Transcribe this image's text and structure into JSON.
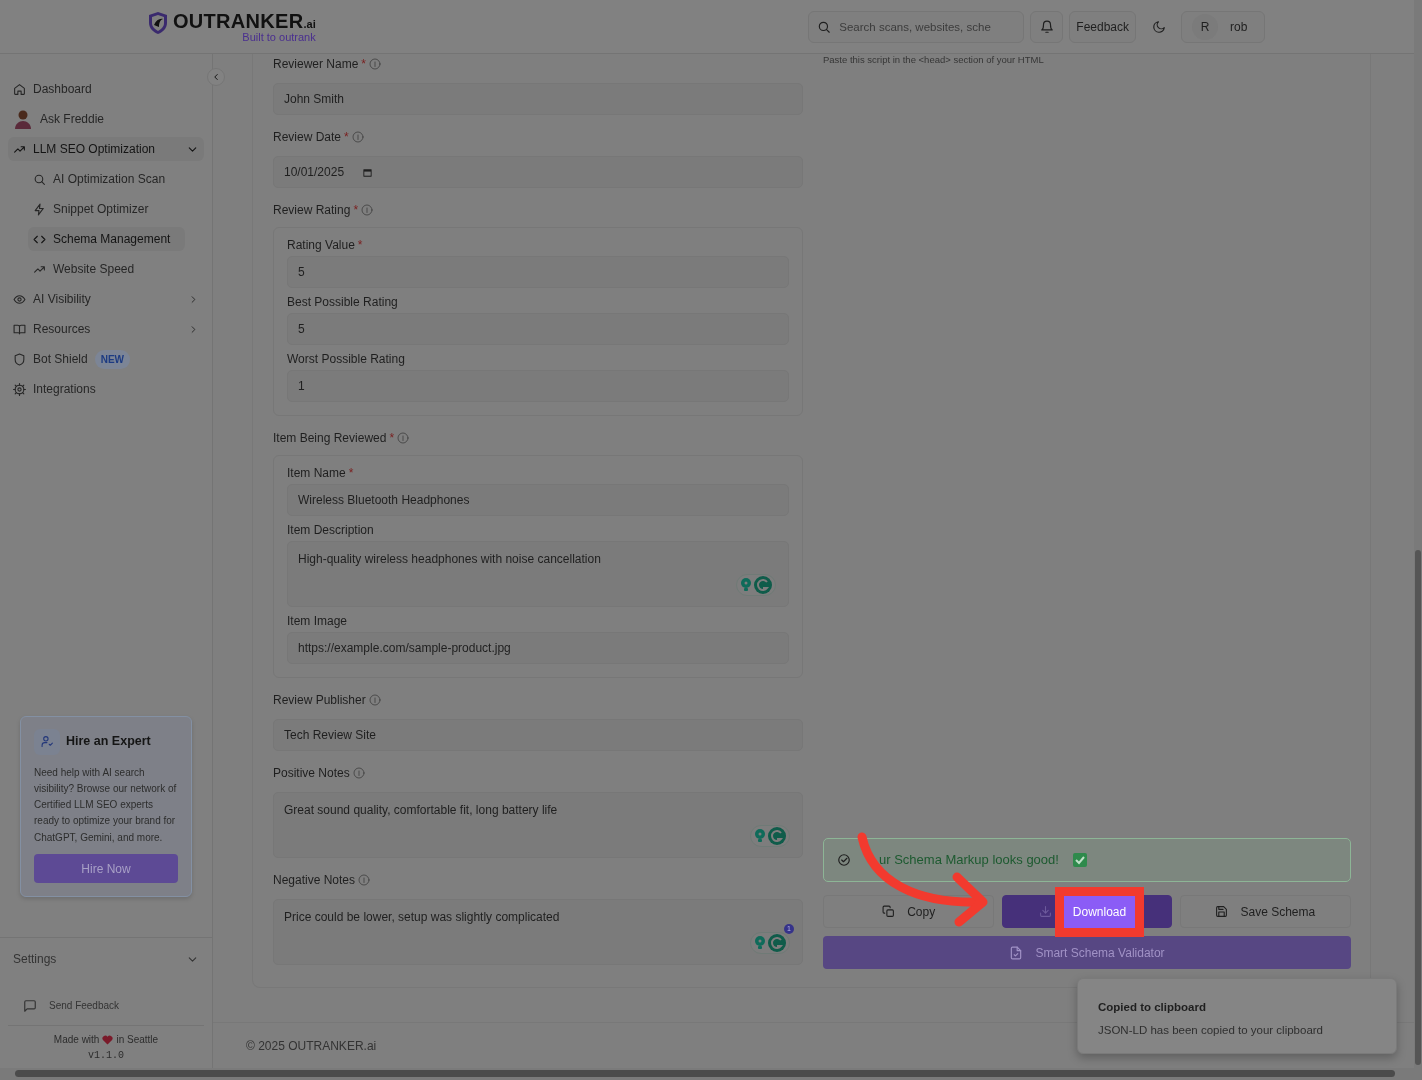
{
  "header": {
    "logo": {
      "name": "OUTRANKER",
      "suffix": ".ai",
      "tagline": "Built to outrank"
    },
    "search": {
      "placeholder": "Search scans, websites, sche"
    },
    "feedback_button": "Feedback",
    "user": {
      "initial": "R",
      "name": "rob"
    }
  },
  "sidebar": {
    "items": [
      {
        "label": "Dashboard",
        "selected": false
      },
      {
        "label": "Ask Freddie",
        "selected": false
      },
      {
        "label": "LLM SEO Optimization",
        "selected": true,
        "expanded": true,
        "children": [
          {
            "label": "AI Optimization Scan",
            "selected": false
          },
          {
            "label": "Snippet Optimizer",
            "selected": false
          },
          {
            "label": "Schema Management",
            "selected": true
          },
          {
            "label": "Website Speed",
            "selected": false
          }
        ]
      },
      {
        "label": "AI Visibility",
        "selected": false,
        "expanded": false
      },
      {
        "label": "Resources",
        "selected": false,
        "expanded": false
      },
      {
        "label": "Bot Shield",
        "selected": false,
        "badge": "NEW"
      },
      {
        "label": "Integrations",
        "selected": false
      }
    ],
    "promo": {
      "title": "Hire an Expert",
      "text": "Need help with AI search visibility? Browse our network of Certified LLM SEO experts ready to optimize your brand for ChatGPT, Gemini, and more.",
      "button": "Hire Now"
    },
    "settings": {
      "label": "Settings",
      "expanded": false
    },
    "send_feedback": "Send Feedback",
    "made_with": {
      "before": "Made with",
      "after": "in Seattle"
    },
    "version": "v1.1.0"
  },
  "form": {
    "fields": [
      {
        "kind": "text",
        "label": "Reviewer Name",
        "required_mark": "*",
        "info": true,
        "value": "John Smith"
      },
      {
        "kind": "date",
        "label": "Review Date",
        "required_mark": "*",
        "info": true,
        "value": "10/01/2025"
      },
      {
        "kind": "group",
        "label": "Review Rating",
        "required_mark": "*",
        "info": true,
        "fields": [
          {
            "kind": "text",
            "label": "Rating Value",
            "required_mark": "*",
            "value": "5"
          },
          {
            "kind": "text",
            "label": "Best Possible Rating",
            "value": "5"
          },
          {
            "kind": "text",
            "label": "Worst Possible Rating",
            "value": "1"
          }
        ]
      },
      {
        "kind": "group",
        "label": "Item Being Reviewed",
        "required_mark": "*",
        "info": true,
        "fields": [
          {
            "kind": "text",
            "label": "Item Name",
            "required_mark": "*",
            "value": "Wireless Bluetooth Headphones"
          },
          {
            "kind": "textarea",
            "label": "Item Description",
            "value": "High-quality wireless headphones with noise cancellation"
          },
          {
            "kind": "text",
            "label": "Item Image",
            "value": "https://example.com/sample-product.jpg"
          }
        ]
      },
      {
        "kind": "text",
        "label": "Review Publisher",
        "info": true,
        "value": "Tech Review Site"
      },
      {
        "kind": "textarea",
        "label": "Positive Notes",
        "info": true,
        "value": "Great sound quality, comfortable fit, long battery life"
      },
      {
        "kind": "textarea",
        "label": "Negative Notes",
        "info": true,
        "value": "Price could be lower, setup was slightly complicated",
        "assistant_count": "1"
      }
    ]
  },
  "output": {
    "hint": "Paste this script in the <head> section of your HTML",
    "status": {
      "text": "ur Schema Markup looks good!",
      "ok": true
    },
    "actions": [
      {
        "kind": "copy",
        "label": "Copy",
        "highlighted": false
      },
      {
        "kind": "download",
        "label": "Download",
        "highlighted": true
      },
      {
        "kind": "save",
        "label": "Save Schema",
        "highlighted": false
      }
    ],
    "validator_button": "Smart Schema Validator"
  },
  "footer": "© 2025 OUTRANKER.ai",
  "toast": {
    "title": "Copied to clipboard",
    "message": "JSON-LD has been copied to your clipboard"
  }
}
